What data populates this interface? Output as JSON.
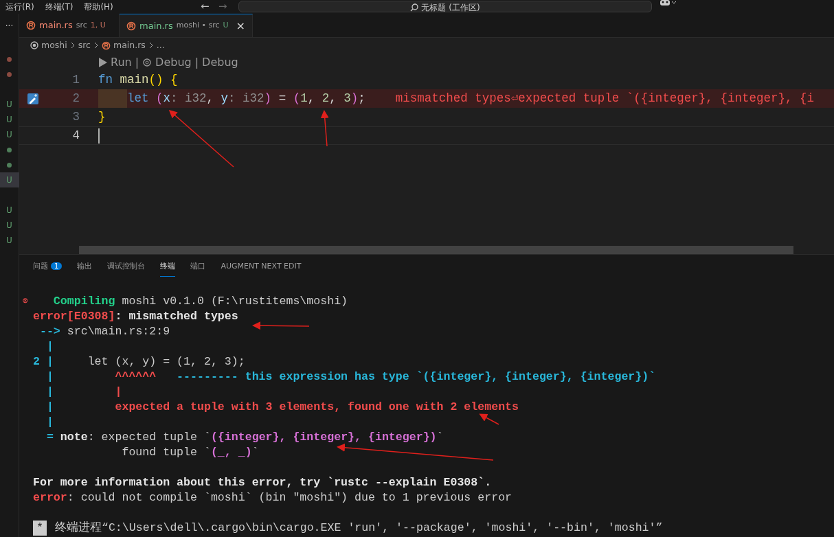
{
  "menu": [
    "运行(R)",
    "终端(T)",
    "帮助(H)"
  ],
  "nav": {
    "back": "←",
    "forward": "→"
  },
  "command_center": {
    "title": "无标题 (工作区)"
  },
  "gutter_marks": [
    {
      "kind": "dot",
      "color": "#8a4a40"
    },
    {
      "kind": "dot",
      "color": "#8a4a40"
    },
    {
      "kind": "gap"
    },
    {
      "kind": "letter",
      "text": "U",
      "color": "#5f9e6e"
    },
    {
      "kind": "letter",
      "text": "U",
      "color": "#5f9e6e"
    },
    {
      "kind": "letter",
      "text": "U",
      "color": "#5f9e6e"
    },
    {
      "kind": "dot",
      "color": "#4f7f5a"
    },
    {
      "kind": "dot",
      "color": "#4f7f5a"
    },
    {
      "kind": "letter",
      "text": "U",
      "color": "#5f9e6e",
      "selected": true
    },
    {
      "kind": "gap"
    },
    {
      "kind": "letter",
      "text": "U",
      "color": "#5f9e6e"
    },
    {
      "kind": "letter",
      "text": "U",
      "color": "#5f9e6e"
    },
    {
      "kind": "letter",
      "text": "U",
      "color": "#5f9e6e"
    }
  ],
  "more_actions": "···",
  "tabs": [
    {
      "label": "main.rs",
      "description": "src",
      "status": "1, U",
      "color": "#f48771",
      "selected": false
    },
    {
      "label": "main.rs",
      "description": "moshi • src",
      "status": "U",
      "color": "#73c991",
      "selected": true,
      "close": "×"
    }
  ],
  "breadcrumb": [
    {
      "kind": "folder",
      "label": "moshi"
    },
    {
      "kind": "plain",
      "label": "src"
    },
    {
      "kind": "file",
      "label": "main.rs"
    },
    {
      "kind": "plain",
      "label": "..."
    }
  ],
  "codelens": [
    {
      "kind": "run",
      "label": "Run"
    },
    {
      "kind": "sep",
      "label": "|"
    },
    {
      "kind": "debug",
      "label": "Debug"
    },
    {
      "kind": "sep",
      "label": "|"
    },
    {
      "kind": "plain",
      "label": "Debug"
    }
  ],
  "code_lines": [
    {
      "number": "1",
      "tokens": [
        {
          "text": "fn ",
          "color": "#569cd6"
        },
        {
          "text": "main",
          "color": "#dcdcaa"
        },
        {
          "text": "() {",
          "color": "#ffd700"
        }
      ]
    },
    {
      "number": "2",
      "error": true,
      "indent_marker": true,
      "tokens": [
        {
          "text": "let ",
          "color": "#569cd6"
        },
        {
          "text": "(",
          "color": "#da70d6"
        },
        {
          "text": "x",
          "color": "#9cdcfe"
        },
        {
          "text": ": i32",
          "color": "#8f8f8f"
        },
        {
          "text": ", ",
          "color": "#d4d4d4"
        },
        {
          "text": "y",
          "color": "#9cdcfe"
        },
        {
          "text": ": i32",
          "color": "#8f8f8f"
        },
        {
          "text": ")",
          "color": "#da70d6"
        },
        {
          "text": " = ",
          "color": "#d4d4d4"
        },
        {
          "text": "(",
          "color": "#da70d6"
        },
        {
          "text": "1",
          "color": "#b5cea8"
        },
        {
          "text": ", ",
          "color": "#d4d4d4"
        },
        {
          "text": "2",
          "color": "#b5cea8"
        },
        {
          "text": ", ",
          "color": "#d4d4d4"
        },
        {
          "text": "3",
          "color": "#b5cea8"
        },
        {
          "text": ")",
          "color": "#da70d6"
        },
        {
          "text": ";",
          "color": "#d4d4d4"
        }
      ],
      "diagnostic": "mismatched types⏎expected tuple `({integer}, {integer}, {i"
    },
    {
      "number": "3",
      "tokens": [
        {
          "text": "}",
          "color": "#ffd700"
        }
      ]
    },
    {
      "number": "4",
      "current": true
    }
  ],
  "panel_tabs": [
    {
      "label": "问题",
      "badge": "1",
      "selected": false
    },
    {
      "label": "输出",
      "selected": false
    },
    {
      "label": "调试控制台",
      "selected": false
    },
    {
      "label": "终端",
      "selected": true
    },
    {
      "label": "端口",
      "selected": false
    },
    {
      "label": "AUGMENT NEXT EDIT",
      "selected": false
    }
  ],
  "terminal_lines": [
    {
      "kind": "error_start",
      "icon": "⊗",
      "tokens": [
        {
          "text": "   Compiling",
          "color": "#23d18b",
          "bold": true
        },
        {
          "text": " moshi v0.1.0 (F:\\rustitems\\moshi)",
          "color": "#cccccc",
          "bold": false
        }
      ]
    },
    {
      "kind": "text",
      "tokens": [
        {
          "text": "error[E0308]",
          "color": "#f14c4c",
          "bold": true
        },
        {
          "text": ": mismatched types",
          "color": "#e5e5e5",
          "bold": true
        }
      ]
    },
    {
      "kind": "text",
      "tokens": [
        {
          "text": " --> ",
          "color": "#29b8db",
          "bold": true
        },
        {
          "text": "src\\main.rs:2:9",
          "color": "#cccccc",
          "bold": false
        }
      ]
    },
    {
      "kind": "text",
      "tokens": [
        {
          "text": "  |",
          "color": "#29b8db",
          "bold": true
        }
      ]
    },
    {
      "kind": "text",
      "tokens": [
        {
          "text": "2 |",
          "color": "#29b8db",
          "bold": true
        },
        {
          "text": "     let (x, y) = (1, 2, 3);",
          "color": "#cccccc",
          "bold": false
        }
      ]
    },
    {
      "kind": "text",
      "tokens": [
        {
          "text": "  |",
          "color": "#29b8db",
          "bold": true
        },
        {
          "text": "         ^^^^^^",
          "color": "#f14c4c",
          "bold": true
        },
        {
          "text": "   --------- this expression has type `({integer}, {integer}, {integer})`",
          "color": "#29b8db",
          "bold": true
        }
      ]
    },
    {
      "kind": "text",
      "tokens": [
        {
          "text": "  |",
          "color": "#29b8db",
          "bold": true
        },
        {
          "text": "         |",
          "color": "#f14c4c",
          "bold": true
        }
      ]
    },
    {
      "kind": "text",
      "tokens": [
        {
          "text": "  |",
          "color": "#29b8db",
          "bold": true
        },
        {
          "text": "         expected a tuple with 3 elements, found one with 2 elements",
          "color": "#f14c4c",
          "bold": true
        }
      ]
    },
    {
      "kind": "text",
      "tokens": [
        {
          "text": "  |",
          "color": "#29b8db",
          "bold": true
        }
      ]
    },
    {
      "kind": "text",
      "tokens": [
        {
          "text": "  = ",
          "color": "#29b8db",
          "bold": true
        },
        {
          "text": "note",
          "color": "#e5e5e5",
          "bold": true
        },
        {
          "text": ": expected tuple `",
          "color": "#cccccc",
          "bold": false
        },
        {
          "text": "({integer}, {integer}, {integer})",
          "color": "#d670d6",
          "bold": true
        },
        {
          "text": "`",
          "bold": false
        }
      ]
    },
    {
      "kind": "text",
      "tokens": [
        {
          "text": "             found tuple `",
          "color": "#cccccc",
          "bold": false
        },
        {
          "text": "(_, _)",
          "color": "#d670d6",
          "bold": true
        },
        {
          "text": "`",
          "bold": false
        }
      ]
    },
    {
      "kind": "blank"
    },
    {
      "kind": "text",
      "tokens": [
        {
          "text": "For more information about this error, try `rustc --explain E0308`.",
          "color": "#e5e5e5",
          "bold": true
        }
      ]
    },
    {
      "kind": "text",
      "tokens": [
        {
          "text": "error",
          "color": "#f14c4c",
          "bold": true
        },
        {
          "text": ": could not compile `moshi` (bin \"moshi\") due to 1 previous error",
          "color": "#cccccc",
          "bold": false
        }
      ]
    },
    {
      "kind": "blank"
    },
    {
      "kind": "notice",
      "marker": "*",
      "tokens": [
        {
          "text": " 终端进程“C:\\Users\\dell\\.cargo\\bin\\cargo.EXE 'run', '--package', 'moshi', '--bin', 'moshi'”",
          "color": "#cccccc",
          "bold": false
        }
      ]
    }
  ]
}
